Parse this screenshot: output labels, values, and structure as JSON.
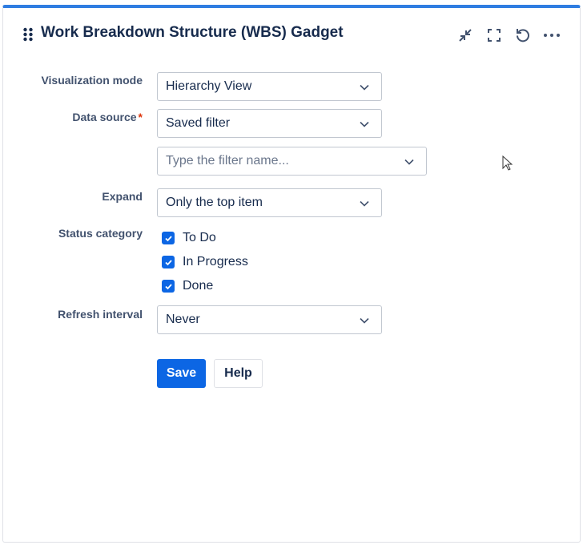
{
  "header": {
    "title": "Work Breakdown Structure (WBS) Gadget"
  },
  "form": {
    "visualization_mode": {
      "label": "Visualization mode",
      "value": "Hierarchy View"
    },
    "data_source": {
      "label": "Data source",
      "required_mark": "*",
      "value": "Saved filter"
    },
    "filter": {
      "placeholder": "Type the filter name..."
    },
    "expand": {
      "label": "Expand",
      "value": "Only the top item"
    },
    "status_category": {
      "label": "Status category",
      "options": [
        {
          "label": "To Do",
          "checked": true
        },
        {
          "label": "In Progress",
          "checked": true
        },
        {
          "label": "Done",
          "checked": true
        }
      ]
    },
    "refresh_interval": {
      "label": "Refresh interval",
      "value": "Never"
    }
  },
  "buttons": {
    "save": "Save",
    "help": "Help"
  },
  "colors": {
    "accent": "#2f7de1",
    "primary": "#0c66e4",
    "required": "#de350b"
  }
}
